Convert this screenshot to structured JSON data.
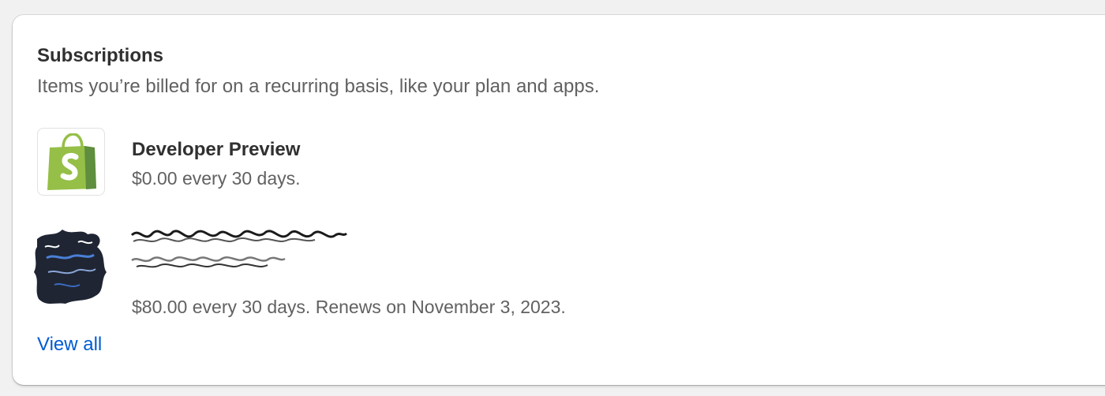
{
  "card": {
    "title": "Subscriptions",
    "description": "Items you’re billed for on a recurring basis, like your plan and apps."
  },
  "subscriptions": [
    {
      "name": "Developer Preview",
      "price": "$0.00 every 30 days.",
      "icon": "shopify-bag-icon"
    },
    {
      "name": "",
      "price": "$80.00 every 30 days. Renews on November 3, 2023.",
      "icon": "redacted-app-icon"
    }
  ],
  "view_all_label": "View all",
  "colors": {
    "background": "#f1f1f1",
    "card": "#ffffff",
    "heading": "#303030",
    "secondary_text": "#616161",
    "link": "#005bd3",
    "shopify_green": "#95bf47",
    "shopify_green_dark": "#5e8e3e"
  }
}
